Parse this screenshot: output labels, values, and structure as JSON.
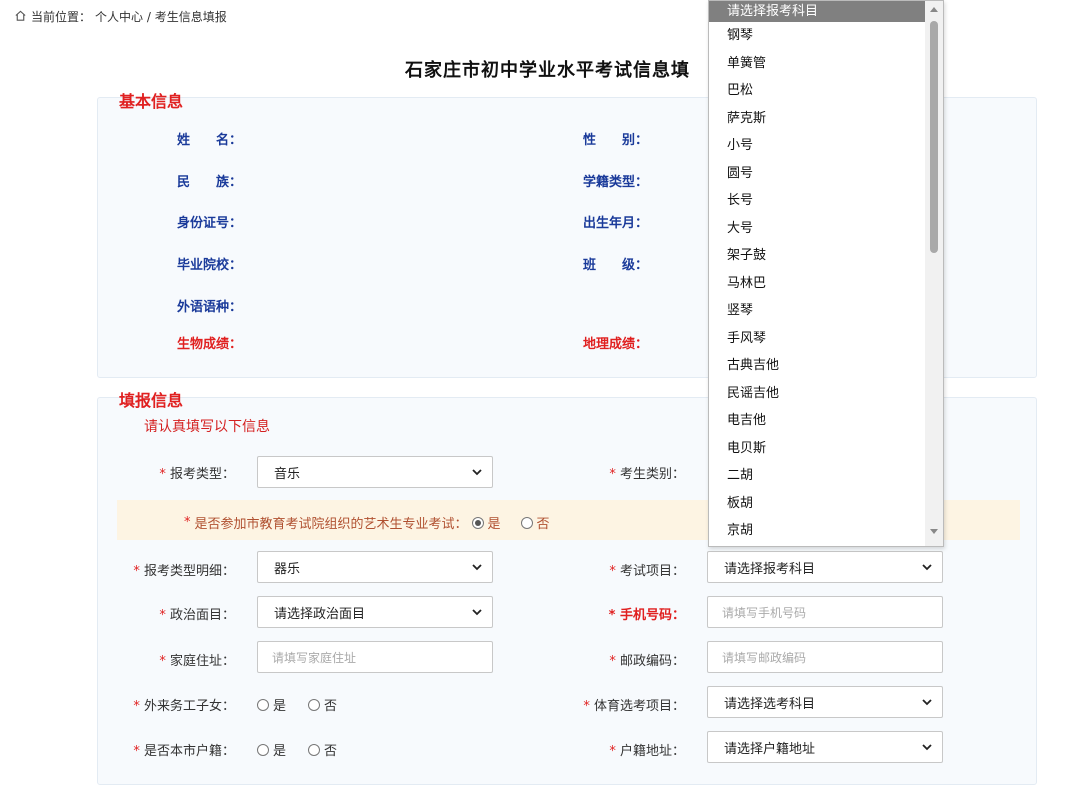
{
  "breadcrumb": {
    "prefix": "当前位置：",
    "path": "个人中心 / 考生信息填报"
  },
  "page_title": "石家庄市初中学业水平考试信息填",
  "basic": {
    "title": "基本信息",
    "labels": {
      "name": "姓　　名：",
      "gender": "性　　别：",
      "ethnicity": "民　　族：",
      "enroll_type": "学籍类型：",
      "id_number": "身份证号：",
      "birth": "出生年月：",
      "school": "毕业院校：",
      "class": "班　　级：",
      "language": "外语语种：",
      "biology": "生物成绩：",
      "geography": "地理成绩："
    }
  },
  "fill": {
    "title": "填报信息",
    "notice": "请认真填写以下信息",
    "required_mark": "*",
    "exam_type": {
      "label": "报考类型：",
      "value": "音乐"
    },
    "student_category": {
      "label": "考生类别："
    },
    "art_exam": {
      "question": "是否参加市教育考试院组织的艺术生专业考试：",
      "yes": "是",
      "no": "否"
    },
    "exam_type_detail": {
      "label": "报考类型明细：",
      "value": "器乐"
    },
    "exam_item": {
      "label": "考试项目：",
      "value": "请选择报考科目"
    },
    "political": {
      "label": "政治面目：",
      "value": "请选择政治面目"
    },
    "phone": {
      "label": "手机号码：",
      "placeholder": "请填写手机号码"
    },
    "address": {
      "label": "家庭住址：",
      "placeholder": "请填写家庭住址"
    },
    "postcode": {
      "label": "邮政编码：",
      "placeholder": "请填写邮政编码"
    },
    "migrant": {
      "label": "外来务工子女：",
      "yes": "是",
      "no": "否"
    },
    "pe_item": {
      "label": "体育选考项目：",
      "value": "请选择选考科目"
    },
    "local_hukou": {
      "label": "是否本市户籍：",
      "yes": "是",
      "no": "否"
    },
    "hukou_address": {
      "label": "户籍地址：",
      "value": "请选择户籍地址"
    }
  },
  "dropdown": {
    "options": [
      "请选择报考科目",
      "钢琴",
      "单簧管",
      "巴松",
      "萨克斯",
      "小号",
      "圆号",
      "长号",
      "大号",
      "架子鼓",
      "马林巴",
      "竖琴",
      "手风琴",
      "古典吉他",
      "民谣吉他",
      "电吉他",
      "电贝斯",
      "二胡",
      "板胡",
      "京胡"
    ],
    "selected_index": 0
  }
}
